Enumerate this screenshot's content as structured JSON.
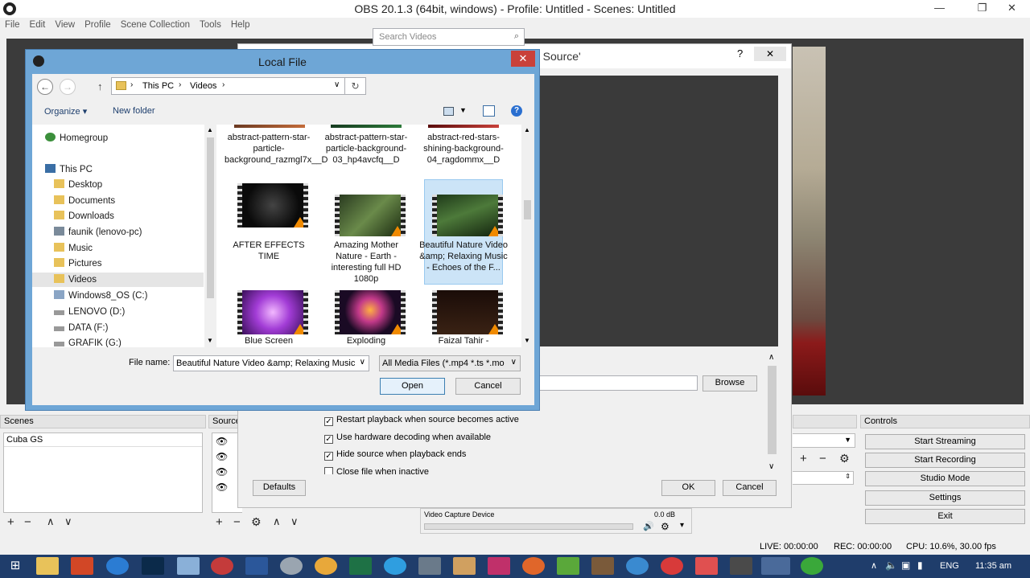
{
  "obs": {
    "title": "OBS 20.1.3 (64bit, windows) - Profile: Untitled - Scenes: Untitled",
    "window_controls": {
      "minimize": "—",
      "maximize": "❐",
      "close": "✕"
    },
    "menu": [
      "File",
      "Edit",
      "View",
      "Profile",
      "Scene Collection",
      "Tools",
      "Help"
    ],
    "scenes_title": "Scenes",
    "scenes": [
      "Cuba GS"
    ],
    "sources_title": "Source",
    "controls_title": "Controls",
    "controls": [
      "Start Streaming",
      "Start Recording",
      "Studio Mode",
      "Settings",
      "Exit"
    ],
    "mixer": {
      "device": "Video Capture Device",
      "level": "0.0 dB"
    },
    "status": {
      "live": "LIVE: 00:00:00",
      "rec": "REC: 00:00:00",
      "cpu": "CPU: 10.6%, 30.00 fps"
    }
  },
  "props": {
    "title": "a Source'",
    "help": "?",
    "close": "✕",
    "browse": "Browse",
    "checks": [
      {
        "label": "Restart playback when source becomes active",
        "checked": true
      },
      {
        "label": "Use hardware decoding when available",
        "checked": true
      },
      {
        "label": "Hide source when playback ends",
        "checked": true
      },
      {
        "label": "Close file when inactive",
        "checked": false
      }
    ],
    "defaults": "Defaults",
    "ok": "OK",
    "cancel": "Cancel"
  },
  "dialog": {
    "title": "Local File",
    "close": "✕",
    "address": [
      "This PC",
      "Videos"
    ],
    "search_placeholder": "Search Videos",
    "organize": "Organize ▾",
    "new_folder": "New folder",
    "nav": [
      "Homegroup",
      "This PC",
      "Desktop",
      "Documents",
      "Downloads",
      "faunik (lenovo-pc)",
      "Music",
      "Pictures",
      "Videos",
      "Windows8_OS (C:)",
      "LENOVO (D:)",
      "DATA (F:)",
      "GRAFIK (G:)"
    ],
    "files": [
      {
        "name": "abstract-pattern-star-particle-background_razmgl7x__D"
      },
      {
        "name": "abstract-pattern-star-particle-background-03_hp4avcfq__D"
      },
      {
        "name": "abstract-red-stars-shining-background-04_ragdommx__D"
      },
      {
        "name": "AFTER EFFECTS TIME"
      },
      {
        "name": "Amazing Mother Nature - Earth - interesting full HD 1080p"
      },
      {
        "name": "Beautiful Nature Video &amp; Relaxing Music - Echoes of the F..."
      },
      {
        "name": "Blue Screen"
      },
      {
        "name": "Exploding"
      },
      {
        "name": "Faizal Tahir -"
      }
    ],
    "file_name_label": "File name:",
    "file_name_value": "Beautiful Nature Video &amp; Relaxing Music",
    "filter": "All Media Files (*.mp4 *.ts *.mo",
    "open": "Open",
    "cancel": "Cancel"
  },
  "taskbar": {
    "lang": "ENG",
    "time": "11:35 am"
  }
}
